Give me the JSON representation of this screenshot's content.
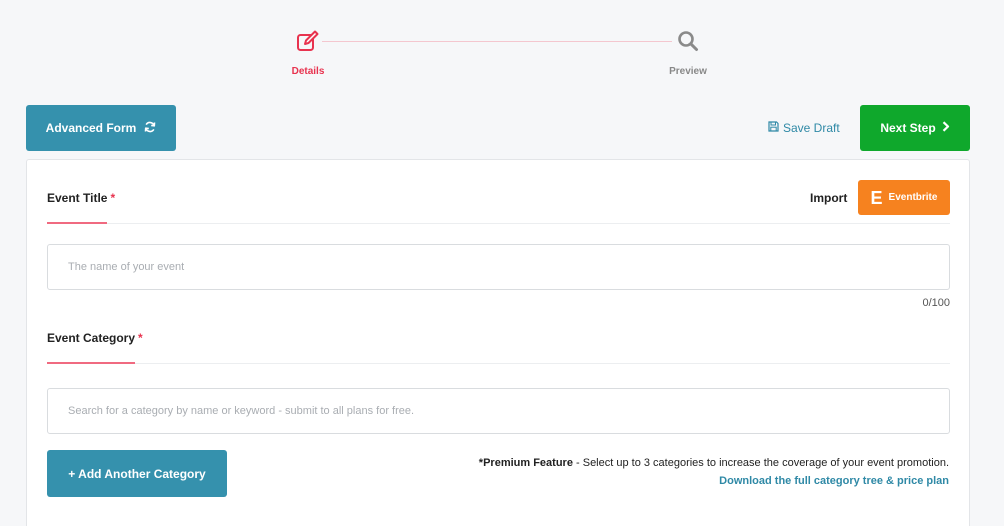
{
  "stepper": {
    "steps": [
      {
        "label": "Details",
        "icon": "edit-icon",
        "active": true
      },
      {
        "label": "Preview",
        "icon": "search-icon",
        "active": false
      }
    ]
  },
  "toolbar": {
    "advanced_form_label": "Advanced Form",
    "save_draft_label": "Save Draft",
    "next_step_label": "Next Step"
  },
  "event_title": {
    "label": "Event Title",
    "required_mark": "*",
    "import_label": "Import",
    "eventbrite_letter": "E",
    "eventbrite_label": "Eventbrite",
    "input_value": "",
    "placeholder": "The name of your event",
    "counter": "0/100"
  },
  "event_category": {
    "label": "Event Category",
    "required_mark": "*",
    "input_value": "",
    "placeholder": "Search for a category by name or keyword - submit to all plans for free.",
    "add_button_label": "+ Add Another Category",
    "premium_strong": "*Premium Feature",
    "premium_text": " - Select up to 3 categories to increase the coverage of your event promotion.",
    "download_link_label": "Download the full category tree & price plan"
  },
  "colors": {
    "accent_red": "#e8334f",
    "primary_blue": "#3591ad",
    "success_green": "#0fa82c",
    "eventbrite_orange": "#f6821f",
    "link_blue": "#2f89a6"
  }
}
